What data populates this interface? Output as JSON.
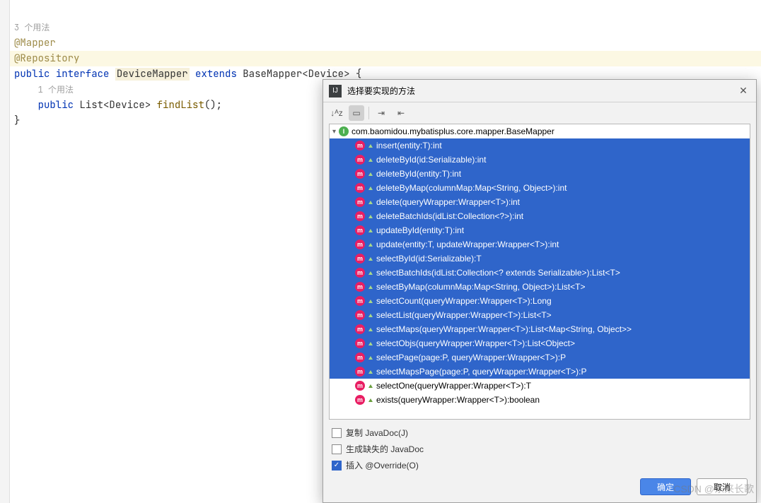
{
  "editor": {
    "usage_top": "3 个用法",
    "anno_mapper": "@Mapper",
    "anno_repo": "@Repository",
    "kw_public": "public",
    "kw_interface": "interface",
    "class_name": "DeviceMapper",
    "kw_extends": "extends",
    "base_mapper": "BaseMapper",
    "generic": "Device",
    "brace_open": "{",
    "usage_inner": "1 个用法",
    "method_line_prefix": "public",
    "method_return": "List<Device>",
    "method_name": "findList",
    "method_parens": "();",
    "brace_close": "}"
  },
  "dialog": {
    "title": "选择要实现的方法",
    "root_label": "com.baomidou.mybatisplus.core.mapper.BaseMapper",
    "methods": [
      {
        "sig": "insert(entity:T):int",
        "sel": true
      },
      {
        "sig": "deleteById(id:Serializable):int",
        "sel": true
      },
      {
        "sig": "deleteById(entity:T):int",
        "sel": true
      },
      {
        "sig": "deleteByMap(columnMap:Map<String, Object>):int",
        "sel": true
      },
      {
        "sig": "delete(queryWrapper:Wrapper<T>):int",
        "sel": true
      },
      {
        "sig": "deleteBatchIds(idList:Collection<?>):int",
        "sel": true
      },
      {
        "sig": "updateById(entity:T):int",
        "sel": true
      },
      {
        "sig": "update(entity:T, updateWrapper:Wrapper<T>):int",
        "sel": true
      },
      {
        "sig": "selectById(id:Serializable):T",
        "sel": true
      },
      {
        "sig": "selectBatchIds(idList:Collection<? extends Serializable>):List<T>",
        "sel": true
      },
      {
        "sig": "selectByMap(columnMap:Map<String, Object>):List<T>",
        "sel": true
      },
      {
        "sig": "selectCount(queryWrapper:Wrapper<T>):Long",
        "sel": true
      },
      {
        "sig": "selectList(queryWrapper:Wrapper<T>):List<T>",
        "sel": true
      },
      {
        "sig": "selectMaps(queryWrapper:Wrapper<T>):List<Map<String, Object>>",
        "sel": true
      },
      {
        "sig": "selectObjs(queryWrapper:Wrapper<T>):List<Object>",
        "sel": true
      },
      {
        "sig": "selectPage(page:P, queryWrapper:Wrapper<T>):P",
        "sel": true
      },
      {
        "sig": "selectMapsPage(page:P, queryWrapper:Wrapper<T>):P",
        "sel": true
      },
      {
        "sig": "selectOne(queryWrapper:Wrapper<T>):T",
        "sel": false
      },
      {
        "sig": "exists(queryWrapper:Wrapper<T>):boolean",
        "sel": false
      }
    ],
    "chk_copy_javadoc": "复制 JavaDoc(J)",
    "chk_gen_missing": "生成缺失的 JavaDoc",
    "chk_insert_override": "插入 @Override(O)",
    "btn_ok": "确定",
    "btn_cancel": "取消"
  },
  "watermark": "CSDN @东来长歌"
}
